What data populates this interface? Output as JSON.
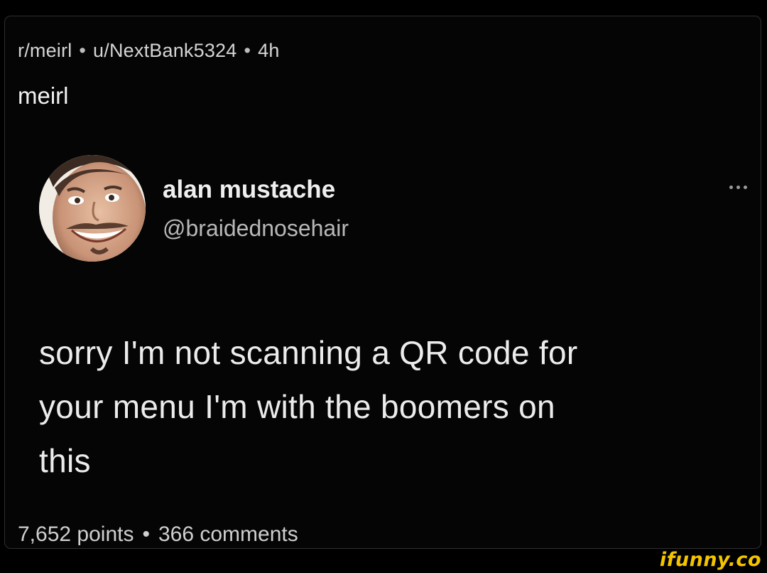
{
  "post": {
    "subreddit": "r/meirl",
    "separator": "•",
    "author": "u/NextBank5324",
    "age": "4h",
    "title": "meirl",
    "points": "7,652 points",
    "comments": "366 comments"
  },
  "tweet": {
    "display_name": "alan mustache",
    "handle": "@braidednosehair",
    "text_lines": [
      "sorry I'm not scanning a QR code for",
      "your menu I'm with the boomers on",
      "this"
    ],
    "more_icon": "ellipsis-icon",
    "avatar_icon": "avatar-face"
  },
  "watermark": {
    "text": "ifunny.co"
  },
  "colors": {
    "background": "#000000",
    "card_border": "#2e2e2e",
    "text_primary": "#ececec",
    "text_secondary": "#b8b8b8",
    "watermark": "#f3c400"
  }
}
